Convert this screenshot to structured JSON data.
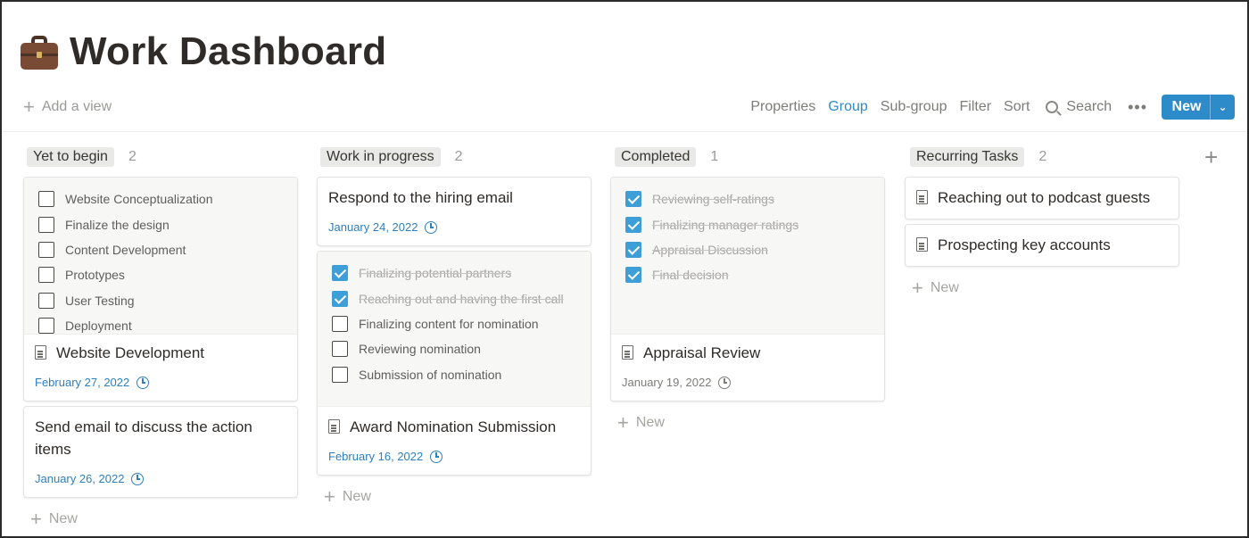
{
  "page": {
    "title": "Work Dashboard",
    "icon": "briefcase-icon"
  },
  "toolbar": {
    "add_view_label": "Add a view",
    "properties_label": "Properties",
    "group_label": "Group",
    "subgroup_label": "Sub-group",
    "filter_label": "Filter",
    "sort_label": "Sort",
    "search_label": "Search",
    "more_label": "•••",
    "new_label": "New",
    "accent_color": "#2e8bc9"
  },
  "board": {
    "add_group_label": "+",
    "columns": [
      {
        "label": "Yet to begin",
        "count": "2",
        "new_label": "New",
        "cards": [
          {
            "title": "Website Development",
            "date": "February 27, 2022",
            "todos": [
              {
                "text": "Website Conceptualization",
                "checked": false
              },
              {
                "text": "Finalize the design",
                "checked": false
              },
              {
                "text": "Content Development",
                "checked": false
              },
              {
                "text": "Prototypes",
                "checked": false
              },
              {
                "text": "User Testing",
                "checked": false
              },
              {
                "text": "Deployment",
                "checked": false
              }
            ]
          },
          {
            "title": "Send email to discuss the action items",
            "date": "January 26, 2022"
          }
        ]
      },
      {
        "label": "Work in progress",
        "count": "2",
        "new_label": "New",
        "cards": [
          {
            "title": "Respond to the hiring email",
            "date": "January 24, 2022"
          },
          {
            "title": "Award Nomination Submission",
            "date": "February 16, 2022",
            "todos": [
              {
                "text": "Finalizing potential partners",
                "checked": true
              },
              {
                "text": "Reaching out and having the first call",
                "checked": true
              },
              {
                "text": "Finalizing content for nomination",
                "checked": false
              },
              {
                "text": "Reviewing nomination",
                "checked": false
              },
              {
                "text": "Submission of nomination",
                "checked": false
              }
            ]
          }
        ]
      },
      {
        "label": "Completed",
        "count": "1",
        "new_label": "New",
        "cards": [
          {
            "title": "Appraisal Review",
            "date": "January 19, 2022",
            "todos": [
              {
                "text": "Reviewing self-ratings",
                "checked": true
              },
              {
                "text": "Finalizing manager ratings",
                "checked": true
              },
              {
                "text": "Appraisal Discussion",
                "checked": true
              },
              {
                "text": "Final decision",
                "checked": true
              }
            ]
          }
        ]
      },
      {
        "label": "Recurring Tasks",
        "count": "2",
        "new_label": "New",
        "cards": [
          {
            "title": "Reaching out to podcast guests"
          },
          {
            "title": "Prospecting key accounts"
          }
        ]
      }
    ]
  }
}
